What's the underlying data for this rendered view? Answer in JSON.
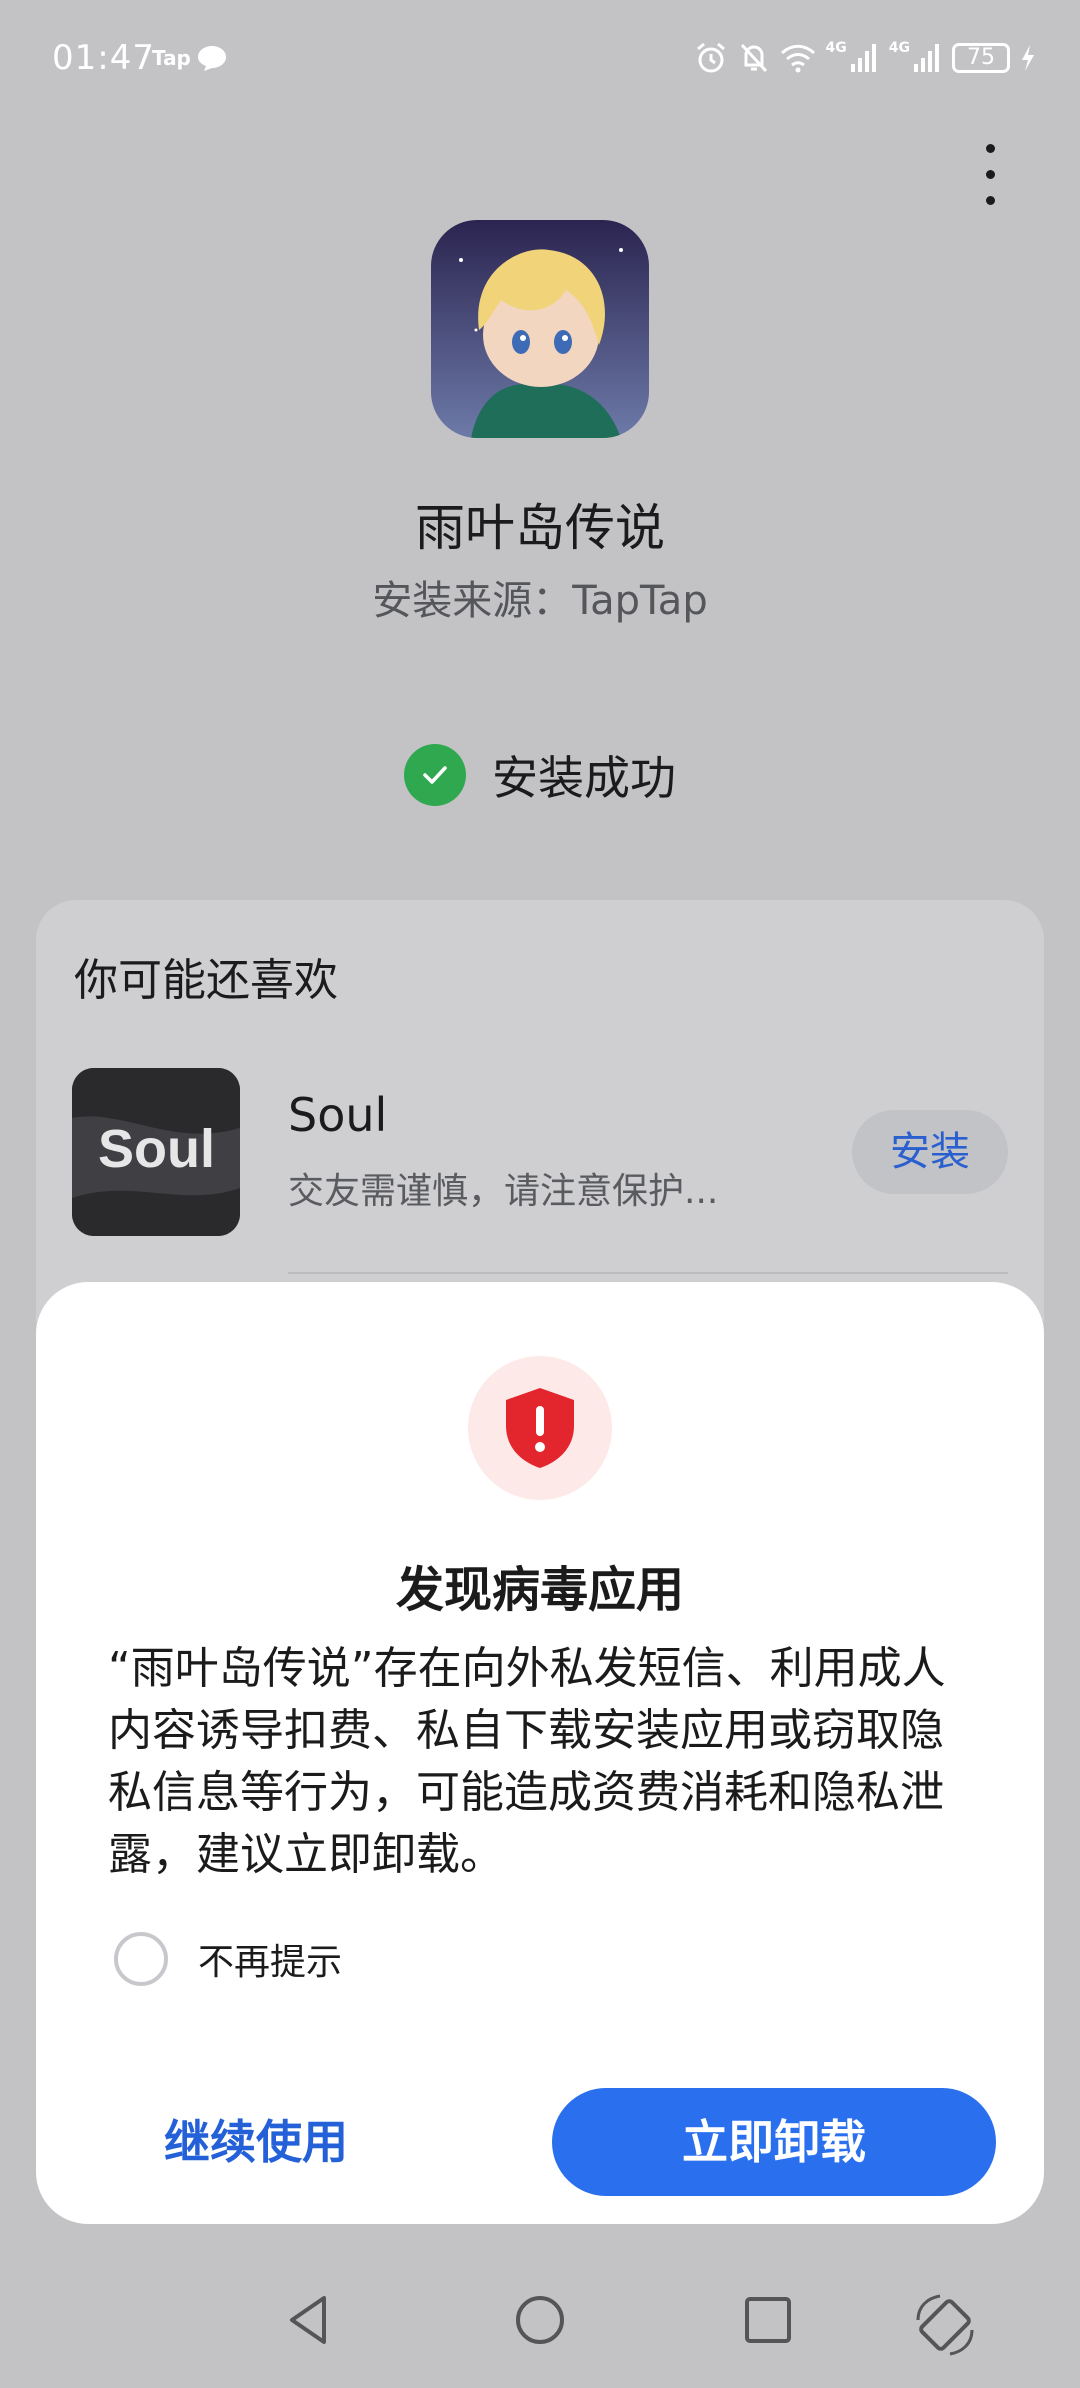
{
  "status_bar": {
    "time": "01:47",
    "notification_label": "Tap",
    "network_1": "4G",
    "network_2": "4G",
    "battery": "75"
  },
  "app": {
    "name": "雨叶岛传说",
    "install_source": "安装来源：TapTap",
    "status_text": "安装成功"
  },
  "recommendations": {
    "title": "你可能还喜欢",
    "items": [
      {
        "name": "Soul",
        "icon_text": "Soul",
        "description": "交友需谨慎，请注意保护...",
        "install_label": "安装"
      }
    ]
  },
  "dialog": {
    "title": "发现病毒应用",
    "message": "“雨叶岛传说”存在向外私发短信、利用成人内容诱导扣费、私自下载安装应用或窃取隐私信息等行为，可能造成资费消耗和隐私泄露，建议立即卸载。",
    "checkbox_label": "不再提示",
    "continue_label": "继续使用",
    "uninstall_label": "立即卸载"
  },
  "colors": {
    "primary_blue": "#2a6fee",
    "success_green": "#2fa84f",
    "danger_red": "#e3262d",
    "scrim_background": "#c3c3c6"
  },
  "icons": {
    "status": [
      "alarm-icon",
      "mute-icon",
      "wifi-icon",
      "signal-icon",
      "signal-icon",
      "charging-icon"
    ],
    "nav": [
      "back-icon",
      "home-icon",
      "recents-icon",
      "rotate-icon"
    ]
  }
}
